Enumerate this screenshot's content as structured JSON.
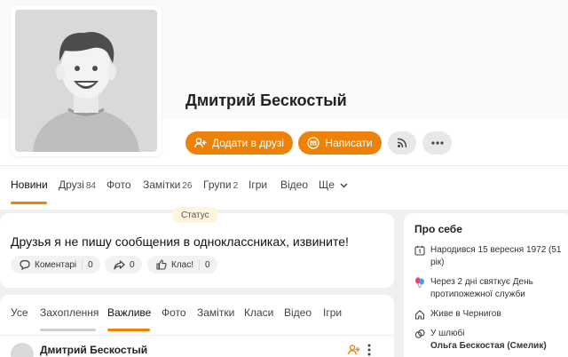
{
  "profile": {
    "name": "Дмитрий Бескостый"
  },
  "actions": {
    "add_friend_label": "Додати в друзі",
    "write_label": "Написати"
  },
  "profile_tabs": [
    {
      "label": "Новини",
      "count": ""
    },
    {
      "label": "Друзі",
      "count": "84"
    },
    {
      "label": "Фото",
      "count": ""
    },
    {
      "label": "Замітки",
      "count": "26"
    },
    {
      "label": "Групи",
      "count": "2"
    },
    {
      "label": "Ігри",
      "count": ""
    },
    {
      "label": "Відео",
      "count": ""
    },
    {
      "label": "Ще",
      "count": ""
    }
  ],
  "status": {
    "badge": "Статус",
    "text": "Друзья я не пишу сообщения в одноклассниках, извините!",
    "comments_label": "Коментарі",
    "comments_count": "0",
    "shares_count": "0",
    "likes_label": "Клас!",
    "likes_count": "0"
  },
  "feed": {
    "tabs": [
      "Усе",
      "Захоплення",
      "Важливе",
      "Фото",
      "Замітки",
      "Класи",
      "Відео",
      "Ігри"
    ],
    "post_author": "Дмитрий Бескостый"
  },
  "about": {
    "title": "Про себе",
    "birth": "Народився 15 вересня 1972 (51 рік)",
    "holiday": "Через 2 дні святкує День протипожежної служби",
    "location": "Живе в Чернигов",
    "marriage_label": "У шлюбі",
    "spouse": "Ольга Бескостая (Смелик)"
  },
  "colors": {
    "accent": "#ee8208",
    "background": "#f0f0f0"
  }
}
